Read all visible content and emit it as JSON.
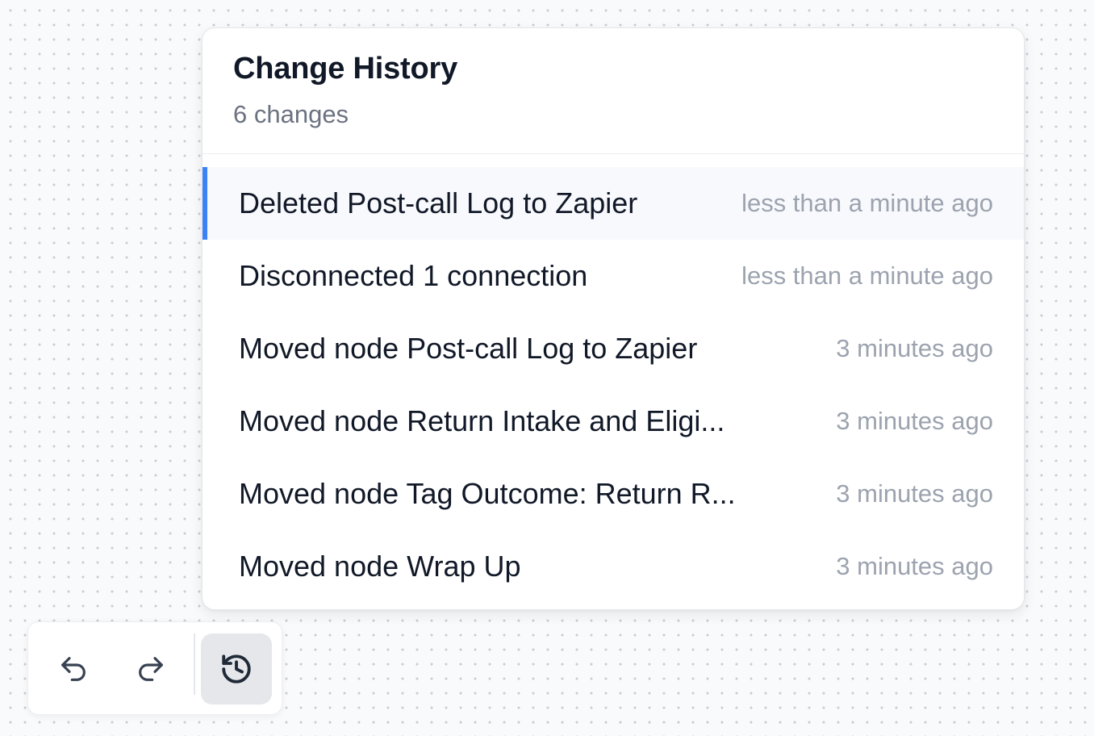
{
  "history": {
    "title": "Change History",
    "count_label": "6 changes",
    "items": [
      {
        "label": "Deleted Post-call Log to Zapier",
        "time": "less than a minute ago",
        "active": true
      },
      {
        "label": "Disconnected 1 connection",
        "time": "less than a minute ago",
        "active": false
      },
      {
        "label": "Moved node Post-call Log to Zapier",
        "time": "3 minutes ago",
        "active": false
      },
      {
        "label": "Moved node Return Intake and Eligi...",
        "time": "3 minutes ago",
        "active": false
      },
      {
        "label": "Moved node Tag Outcome: Return R...",
        "time": "3 minutes ago",
        "active": false
      },
      {
        "label": "Moved node Wrap Up",
        "time": "3 minutes ago",
        "active": false
      }
    ]
  },
  "toolbar": {
    "undo_icon": "undo-icon",
    "redo_icon": "redo-icon",
    "history_icon": "history-icon",
    "history_active": true
  },
  "colors": {
    "accent": "#3b82f6",
    "active_button_bg": "#e5e7eb"
  }
}
